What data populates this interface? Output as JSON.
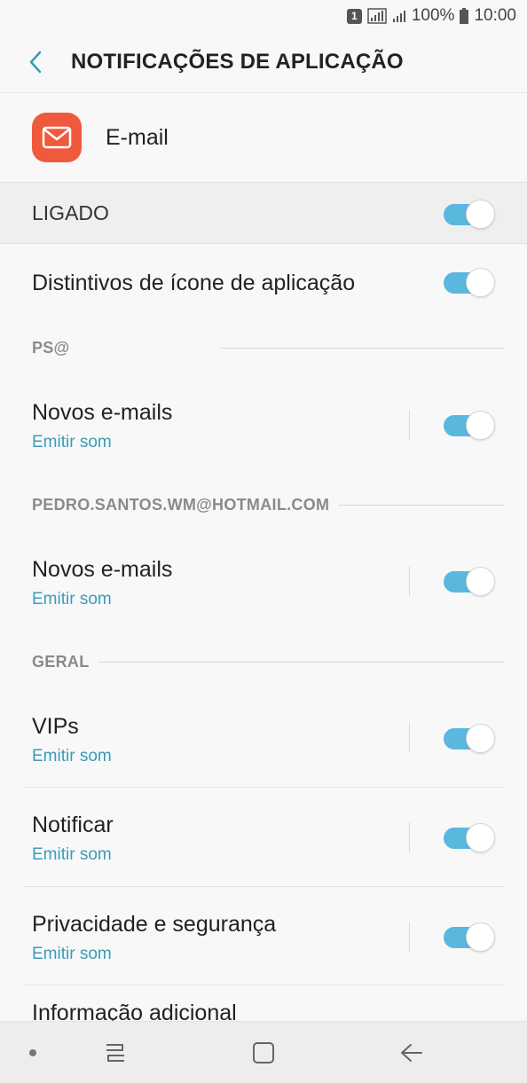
{
  "status_bar": {
    "sim_number": "1",
    "battery": "100%",
    "time": "10:00"
  },
  "header": {
    "title": "NOTIFICAÇÕES DE APLICAÇÃO"
  },
  "app": {
    "name": "E-mail",
    "icon": "mail-icon",
    "icon_color": "#f05a3c"
  },
  "master_toggle": {
    "label": "LIGADO",
    "on": true
  },
  "badges_toggle": {
    "label": "Distintivos de ícone de aplicação",
    "on": true
  },
  "sections": [
    {
      "header": "PS@",
      "items": [
        {
          "label": "Novos e-mails",
          "sub": "Emitir som",
          "on": true
        }
      ]
    },
    {
      "header": "PEDRO.SANTOS.WM@HOTMAIL.COM",
      "items": [
        {
          "label": "Novos e-mails",
          "sub": "Emitir som",
          "on": true
        }
      ]
    },
    {
      "header": "GERAL",
      "items": [
        {
          "label": "VIPs",
          "sub": "Emitir som",
          "on": true
        },
        {
          "label": "Notificar",
          "sub": "Emitir som",
          "on": true
        },
        {
          "label": "Privacidade e segurança",
          "sub": "Emitir som",
          "on": true
        },
        {
          "label": "Informação adicional",
          "sub": "",
          "on": true
        }
      ]
    }
  ],
  "colors": {
    "accent": "#5ab8df",
    "sub_text": "#3a9bb8",
    "back_arrow": "#3a9bb8"
  },
  "nav": {
    "icons": [
      "dot-icon",
      "recent-apps-icon",
      "home-icon",
      "back-icon"
    ]
  }
}
